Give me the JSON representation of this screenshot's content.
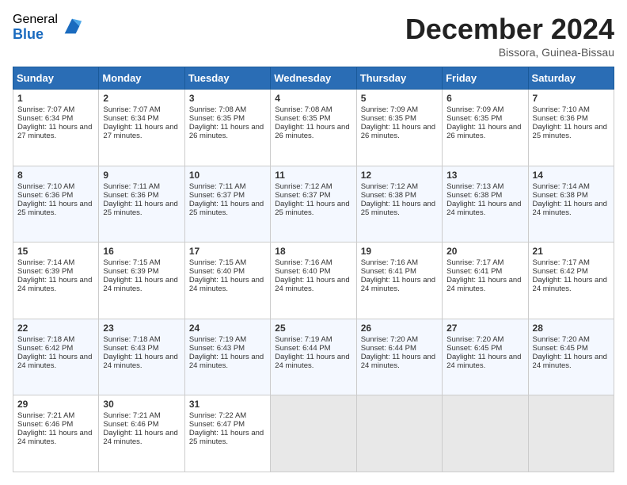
{
  "logo": {
    "general": "General",
    "blue": "Blue"
  },
  "header": {
    "month": "December 2024",
    "location": "Bissora, Guinea-Bissau"
  },
  "weekdays": [
    "Sunday",
    "Monday",
    "Tuesday",
    "Wednesday",
    "Thursday",
    "Friday",
    "Saturday"
  ],
  "weeks": [
    [
      {
        "day": 1,
        "sunrise": "7:07 AM",
        "sunset": "6:34 PM",
        "daylight": "11 hours and 27 minutes."
      },
      {
        "day": 2,
        "sunrise": "7:07 AM",
        "sunset": "6:34 PM",
        "daylight": "11 hours and 27 minutes."
      },
      {
        "day": 3,
        "sunrise": "7:08 AM",
        "sunset": "6:35 PM",
        "daylight": "11 hours and 26 minutes."
      },
      {
        "day": 4,
        "sunrise": "7:08 AM",
        "sunset": "6:35 PM",
        "daylight": "11 hours and 26 minutes."
      },
      {
        "day": 5,
        "sunrise": "7:09 AM",
        "sunset": "6:35 PM",
        "daylight": "11 hours and 26 minutes."
      },
      {
        "day": 6,
        "sunrise": "7:09 AM",
        "sunset": "6:35 PM",
        "daylight": "11 hours and 26 minutes."
      },
      {
        "day": 7,
        "sunrise": "7:10 AM",
        "sunset": "6:36 PM",
        "daylight": "11 hours and 25 minutes."
      }
    ],
    [
      {
        "day": 8,
        "sunrise": "7:10 AM",
        "sunset": "6:36 PM",
        "daylight": "11 hours and 25 minutes."
      },
      {
        "day": 9,
        "sunrise": "7:11 AM",
        "sunset": "6:36 PM",
        "daylight": "11 hours and 25 minutes."
      },
      {
        "day": 10,
        "sunrise": "7:11 AM",
        "sunset": "6:37 PM",
        "daylight": "11 hours and 25 minutes."
      },
      {
        "day": 11,
        "sunrise": "7:12 AM",
        "sunset": "6:37 PM",
        "daylight": "11 hours and 25 minutes."
      },
      {
        "day": 12,
        "sunrise": "7:12 AM",
        "sunset": "6:38 PM",
        "daylight": "11 hours and 25 minutes."
      },
      {
        "day": 13,
        "sunrise": "7:13 AM",
        "sunset": "6:38 PM",
        "daylight": "11 hours and 24 minutes."
      },
      {
        "day": 14,
        "sunrise": "7:14 AM",
        "sunset": "6:38 PM",
        "daylight": "11 hours and 24 minutes."
      }
    ],
    [
      {
        "day": 15,
        "sunrise": "7:14 AM",
        "sunset": "6:39 PM",
        "daylight": "11 hours and 24 minutes."
      },
      {
        "day": 16,
        "sunrise": "7:15 AM",
        "sunset": "6:39 PM",
        "daylight": "11 hours and 24 minutes."
      },
      {
        "day": 17,
        "sunrise": "7:15 AM",
        "sunset": "6:40 PM",
        "daylight": "11 hours and 24 minutes."
      },
      {
        "day": 18,
        "sunrise": "7:16 AM",
        "sunset": "6:40 PM",
        "daylight": "11 hours and 24 minutes."
      },
      {
        "day": 19,
        "sunrise": "7:16 AM",
        "sunset": "6:41 PM",
        "daylight": "11 hours and 24 minutes."
      },
      {
        "day": 20,
        "sunrise": "7:17 AM",
        "sunset": "6:41 PM",
        "daylight": "11 hours and 24 minutes."
      },
      {
        "day": 21,
        "sunrise": "7:17 AM",
        "sunset": "6:42 PM",
        "daylight": "11 hours and 24 minutes."
      }
    ],
    [
      {
        "day": 22,
        "sunrise": "7:18 AM",
        "sunset": "6:42 PM",
        "daylight": "11 hours and 24 minutes."
      },
      {
        "day": 23,
        "sunrise": "7:18 AM",
        "sunset": "6:43 PM",
        "daylight": "11 hours and 24 minutes."
      },
      {
        "day": 24,
        "sunrise": "7:19 AM",
        "sunset": "6:43 PM",
        "daylight": "11 hours and 24 minutes."
      },
      {
        "day": 25,
        "sunrise": "7:19 AM",
        "sunset": "6:44 PM",
        "daylight": "11 hours and 24 minutes."
      },
      {
        "day": 26,
        "sunrise": "7:20 AM",
        "sunset": "6:44 PM",
        "daylight": "11 hours and 24 minutes."
      },
      {
        "day": 27,
        "sunrise": "7:20 AM",
        "sunset": "6:45 PM",
        "daylight": "11 hours and 24 minutes."
      },
      {
        "day": 28,
        "sunrise": "7:20 AM",
        "sunset": "6:45 PM",
        "daylight": "11 hours and 24 minutes."
      }
    ],
    [
      {
        "day": 29,
        "sunrise": "7:21 AM",
        "sunset": "6:46 PM",
        "daylight": "11 hours and 24 minutes."
      },
      {
        "day": 30,
        "sunrise": "7:21 AM",
        "sunset": "6:46 PM",
        "daylight": "11 hours and 24 minutes."
      },
      {
        "day": 31,
        "sunrise": "7:22 AM",
        "sunset": "6:47 PM",
        "daylight": "11 hours and 25 minutes."
      },
      null,
      null,
      null,
      null
    ]
  ]
}
